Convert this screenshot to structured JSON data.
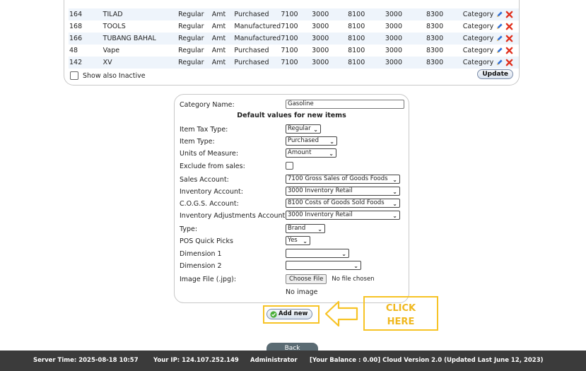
{
  "table": {
    "rows": [
      {
        "id": "164",
        "name": "TILAD",
        "tax": "Regular",
        "uom": "Amt",
        "type": "Purchased",
        "sales": "7100",
        "inv": "3000",
        "cogs": "8100",
        "adj": "3000",
        "extra": "8300",
        "link": "Category"
      },
      {
        "id": "168",
        "name": "TOOLS",
        "tax": "Regular",
        "uom": "Amt",
        "type": "Manufactured",
        "sales": "7100",
        "inv": "3000",
        "cogs": "8100",
        "adj": "3000",
        "extra": "8300",
        "link": "Category"
      },
      {
        "id": "166",
        "name": "TUBANG BAHAL",
        "tax": "Regular",
        "uom": "Amt",
        "type": "Manufactured",
        "sales": "7100",
        "inv": "3000",
        "cogs": "8100",
        "adj": "3000",
        "extra": "8300",
        "link": "Category"
      },
      {
        "id": "48",
        "name": "Vape",
        "tax": "Regular",
        "uom": "Amt",
        "type": "Purchased",
        "sales": "7100",
        "inv": "3000",
        "cogs": "8100",
        "adj": "3000",
        "extra": "8300",
        "link": "Category"
      },
      {
        "id": "142",
        "name": "XV",
        "tax": "Regular",
        "uom": "Amt",
        "type": "Purchased",
        "sales": "7100",
        "inv": "3000",
        "cogs": "8100",
        "adj": "3000",
        "extra": "8300",
        "link": "Category"
      }
    ],
    "show_inactive_label": "Show also Inactive",
    "update_label": "Update"
  },
  "form": {
    "category_name_label": "Category Name:",
    "category_name_value": "Gasoline",
    "section_header": "Default values for new items",
    "item_tax_type_label": "Item Tax Type:",
    "item_tax_type_value": "Regular",
    "item_type_label": "Item Type:",
    "item_type_value": "Purchased",
    "uom_label": "Units of Measure:",
    "uom_value": "Amount",
    "exclude_label": "Exclude from sales:",
    "sales_account_label": "Sales Account:",
    "sales_account_value": "7100   Gross Sales of Goods Foods",
    "inventory_account_label": "Inventory Account:",
    "inventory_account_value": "3000   Inventory Retail",
    "cogs_account_label": "C.O.G.S. Account:",
    "cogs_account_value": "8100   Costs of Goods Sold Foods",
    "inv_adj_label": "Inventory Adjustments Account:",
    "inv_adj_value": "3000   Inventory Retail",
    "type_label": "Type:",
    "type_value": "Brand",
    "pos_label": "POS Quick Picks",
    "pos_value": "Yes",
    "dim1_label": "Dimension 1",
    "dim1_value": "",
    "dim2_label": "Dimension 2",
    "dim2_value": "",
    "image_label": "Image File (.jpg):",
    "choose_file_label": "Choose File",
    "no_file_text": "No file chosen",
    "no_image_text": "No image"
  },
  "actions": {
    "add_new_label": "Add new",
    "click_here_line1": "CLICK",
    "click_here_line2": "HERE",
    "back_label": "Back"
  },
  "footer": {
    "server_time": "Server Time: 2025-08-18 10:57",
    "ip": "Your IP: 124.107.252.149",
    "user": "Administrator",
    "balance": "[Your Balance : 0.00] Cloud Version 2.0 (Updated Last June 12, 2023)"
  },
  "colors": {
    "highlight": "#f7c325",
    "footer_bg": "#3b3b3b",
    "row_alt": "#eef4fb"
  }
}
